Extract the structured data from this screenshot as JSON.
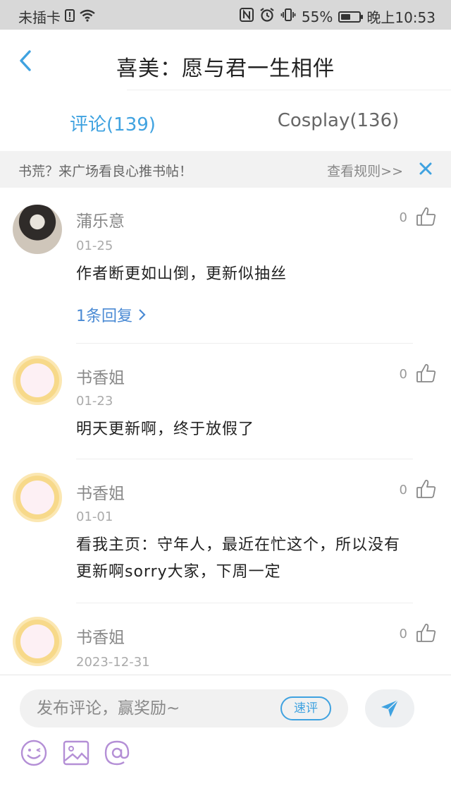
{
  "status_bar": {
    "carrier": "未插卡",
    "battery_percent": "55%",
    "battery_level": 0.55,
    "time": "晚上10:53"
  },
  "header": {
    "title": "喜美：愿与君一生相伴"
  },
  "tabs": [
    {
      "label": "评论(139)",
      "active": true
    },
    {
      "label": "Cosplay(136)",
      "active": false
    }
  ],
  "notice": {
    "text": "书荒？来广场看良心推书帖！",
    "link": "查看规则>>"
  },
  "comments": [
    {
      "author": "蒲乐意",
      "date": "01-25",
      "text": "作者断更如山倒，更新似抽丝",
      "likes": "0",
      "reply": "1条回复"
    },
    {
      "author": "书香姐",
      "date": "01-23",
      "text": "明天更新啊，终于放假了",
      "likes": "0"
    },
    {
      "author": "书香姐",
      "date": "01-01",
      "text_line1": "看我主页：守年人，最近在忙这个，所以没有",
      "text_line2": "更新啊sorry大家，下周一定",
      "likes": "0"
    },
    {
      "author": "书香姐",
      "date": "2023-12-31",
      "likes": "0"
    }
  ],
  "bottom": {
    "input_placeholder": "发布评论，赢奖励~",
    "quick_review": "速评"
  },
  "colors": {
    "accent": "#3fa2e0",
    "link": "#4a8ad4",
    "tool_icon": "#b48fd6"
  }
}
